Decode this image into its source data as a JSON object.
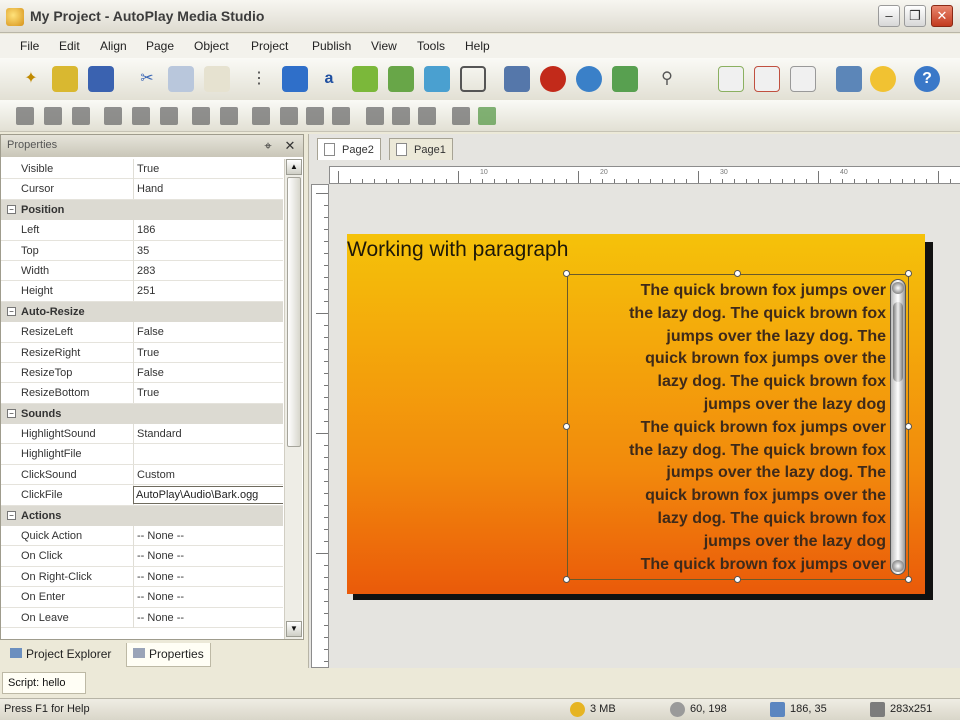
{
  "window": {
    "title": "My Project - AutoPlay Media Studio",
    "minimize": "‒",
    "restore": "❒",
    "close": "✕"
  },
  "menu": [
    "File",
    "Edit",
    "Align",
    "Page",
    "Object",
    "Project",
    "Publish",
    "View",
    "Tools",
    "Help"
  ],
  "properties_panel": {
    "title": "Properties",
    "rows": [
      {
        "type": "prop",
        "key": "Visible",
        "value": "True"
      },
      {
        "type": "prop",
        "key": "Cursor",
        "value": "Hand"
      },
      {
        "type": "cat",
        "key": "Position"
      },
      {
        "type": "prop",
        "key": "Left",
        "value": "186"
      },
      {
        "type": "prop",
        "key": "Top",
        "value": "35"
      },
      {
        "type": "prop",
        "key": "Width",
        "value": "283"
      },
      {
        "type": "prop",
        "key": "Height",
        "value": "251"
      },
      {
        "type": "cat",
        "key": "Auto-Resize"
      },
      {
        "type": "prop",
        "key": "ResizeLeft",
        "value": "False"
      },
      {
        "type": "prop",
        "key": "ResizeRight",
        "value": "True"
      },
      {
        "type": "prop",
        "key": "ResizeTop",
        "value": "False"
      },
      {
        "type": "prop",
        "key": "ResizeBottom",
        "value": "True"
      },
      {
        "type": "cat",
        "key": "Sounds"
      },
      {
        "type": "prop",
        "key": "HighlightSound",
        "value": "Standard"
      },
      {
        "type": "prop",
        "key": "HighlightFile",
        "value": ""
      },
      {
        "type": "prop",
        "key": "ClickSound",
        "value": "Custom"
      },
      {
        "type": "edit",
        "key": "ClickFile",
        "value": "AutoPlay\\Audio\\Bark.ogg"
      },
      {
        "type": "cat",
        "key": "Actions"
      },
      {
        "type": "prop",
        "key": "Quick Action",
        "value": "-- None --"
      },
      {
        "type": "prop",
        "key": "On Click",
        "value": "-- None --"
      },
      {
        "type": "prop",
        "key": "On Right-Click",
        "value": "-- None --"
      },
      {
        "type": "prop",
        "key": "On Enter",
        "value": "-- None --"
      },
      {
        "type": "prop",
        "key": "On Leave",
        "value": "-- None --"
      }
    ]
  },
  "panel_tabs": {
    "explorer": "Project Explorer",
    "properties": "Properties"
  },
  "script_tab": "Script: hello",
  "design": {
    "tabs": {
      "page2": "Page2",
      "page1": "Page1"
    },
    "ruler_labels": [
      "10",
      "20",
      "30",
      "40",
      "50"
    ],
    "heading": "Working with paragraph",
    "paragraph": "The quick brown fox jumps over\nthe lazy dog. The quick brown fox\njumps over the lazy dog. The\nquick brown fox jumps over the\nlazy dog. The quick brown fox\njumps over the lazy dog\nThe quick brown fox jumps over\nthe lazy dog. The quick brown fox\njumps over the lazy dog. The\nquick brown fox jumps over the\nlazy dog. The quick brown fox\njumps over the lazy dog\nThe quick brown fox jumps over"
  },
  "status": {
    "help": "Press F1 for Help",
    "memory": "3 MB",
    "cursor_pos": "60, 198",
    "object_pos": "186, 35",
    "object_size": "283x251"
  },
  "colors": {
    "page_top": "#f5c20a",
    "page_bottom": "#ea5a0a",
    "text": "#3e2a1a"
  }
}
